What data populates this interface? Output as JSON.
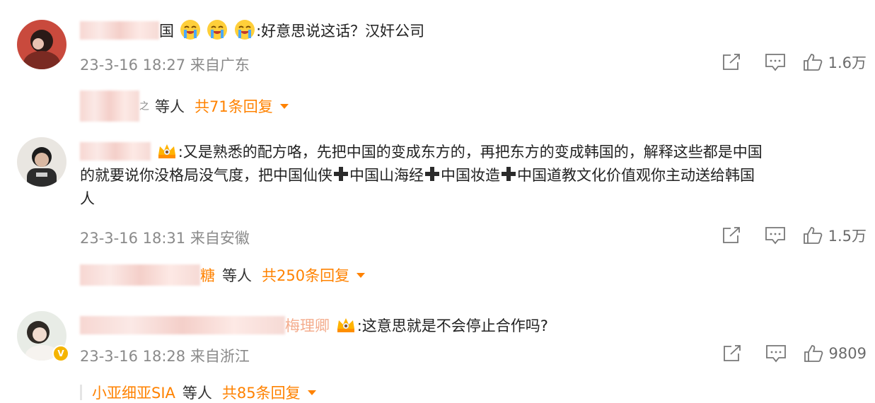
{
  "comments": [
    {
      "name_suffix": "国",
      "text": ":好意思说这话？汉奸公司",
      "emoji_count": 3,
      "meta": "23-3-16 18:27 来自广东",
      "likes": "1.6万",
      "reply_user_suffix": "之",
      "reply_etc": "等人",
      "reply_count": "共71条回复"
    },
    {
      "text_line1": ":又是熟悉的配方咯，先把中国的变成东方的，再把东方的变成韩国的，解释这些都是中国",
      "text_line2_parts": [
        "的就要说你没格局没气度，把中国仙侠",
        "中国山海经",
        "中国妆造",
        "中国道教文化价值观你主动送给韩国"
      ],
      "text_line3": "人",
      "meta": "23-3-16 18:31 来自安徽",
      "likes": "1.5万",
      "reply_user_suffix": "糖",
      "reply_etc": "等人",
      "reply_count": "共250条回复"
    },
    {
      "name_suffix": "梅理卿",
      "text": ":这意思就是不会停止合作吗?",
      "meta": "23-3-16 18:28 来自浙江",
      "likes": "9809",
      "reply_user": "小亚细亚SIA",
      "reply_etc": "等人",
      "reply_count": "共85条回复"
    }
  ],
  "icons": {
    "share": "share-icon",
    "comment": "comment-icon",
    "like": "thumbs-up-icon"
  },
  "colors": {
    "accent": "#ff8200",
    "meta_text": "#8a8a8a"
  }
}
